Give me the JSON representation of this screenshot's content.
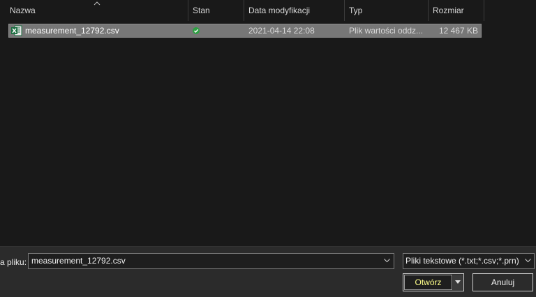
{
  "columns": {
    "name": "Nazwa",
    "status": "Stan",
    "date_modified": "Data modyfikacji",
    "type": "Typ",
    "size": "Rozmiar"
  },
  "files": [
    {
      "name": "measurement_12792.csv",
      "status_icon": "sync-ok-icon",
      "date_modified": "2021-04-14 22:08",
      "type": "Plik wartości oddz...",
      "size": "12 467 KB",
      "icon": "excel-csv-icon",
      "selected": true
    }
  ],
  "bottom_bar": {
    "file_name_label": "a pliku:",
    "file_name_value": "measurement_12792.csv",
    "file_type_value": "Pliki tekstowe (*.txt;*.csv;*.prn)",
    "open_label": "Otwórz",
    "cancel_label": "Anuluj"
  },
  "colors": {
    "background": "#191919",
    "selected_row": "#777777",
    "bottom_bar": "#2b2b2b",
    "excel_green": "#1d6f42",
    "status_green": "#2ea043",
    "focus_text": "#ffff8a"
  }
}
